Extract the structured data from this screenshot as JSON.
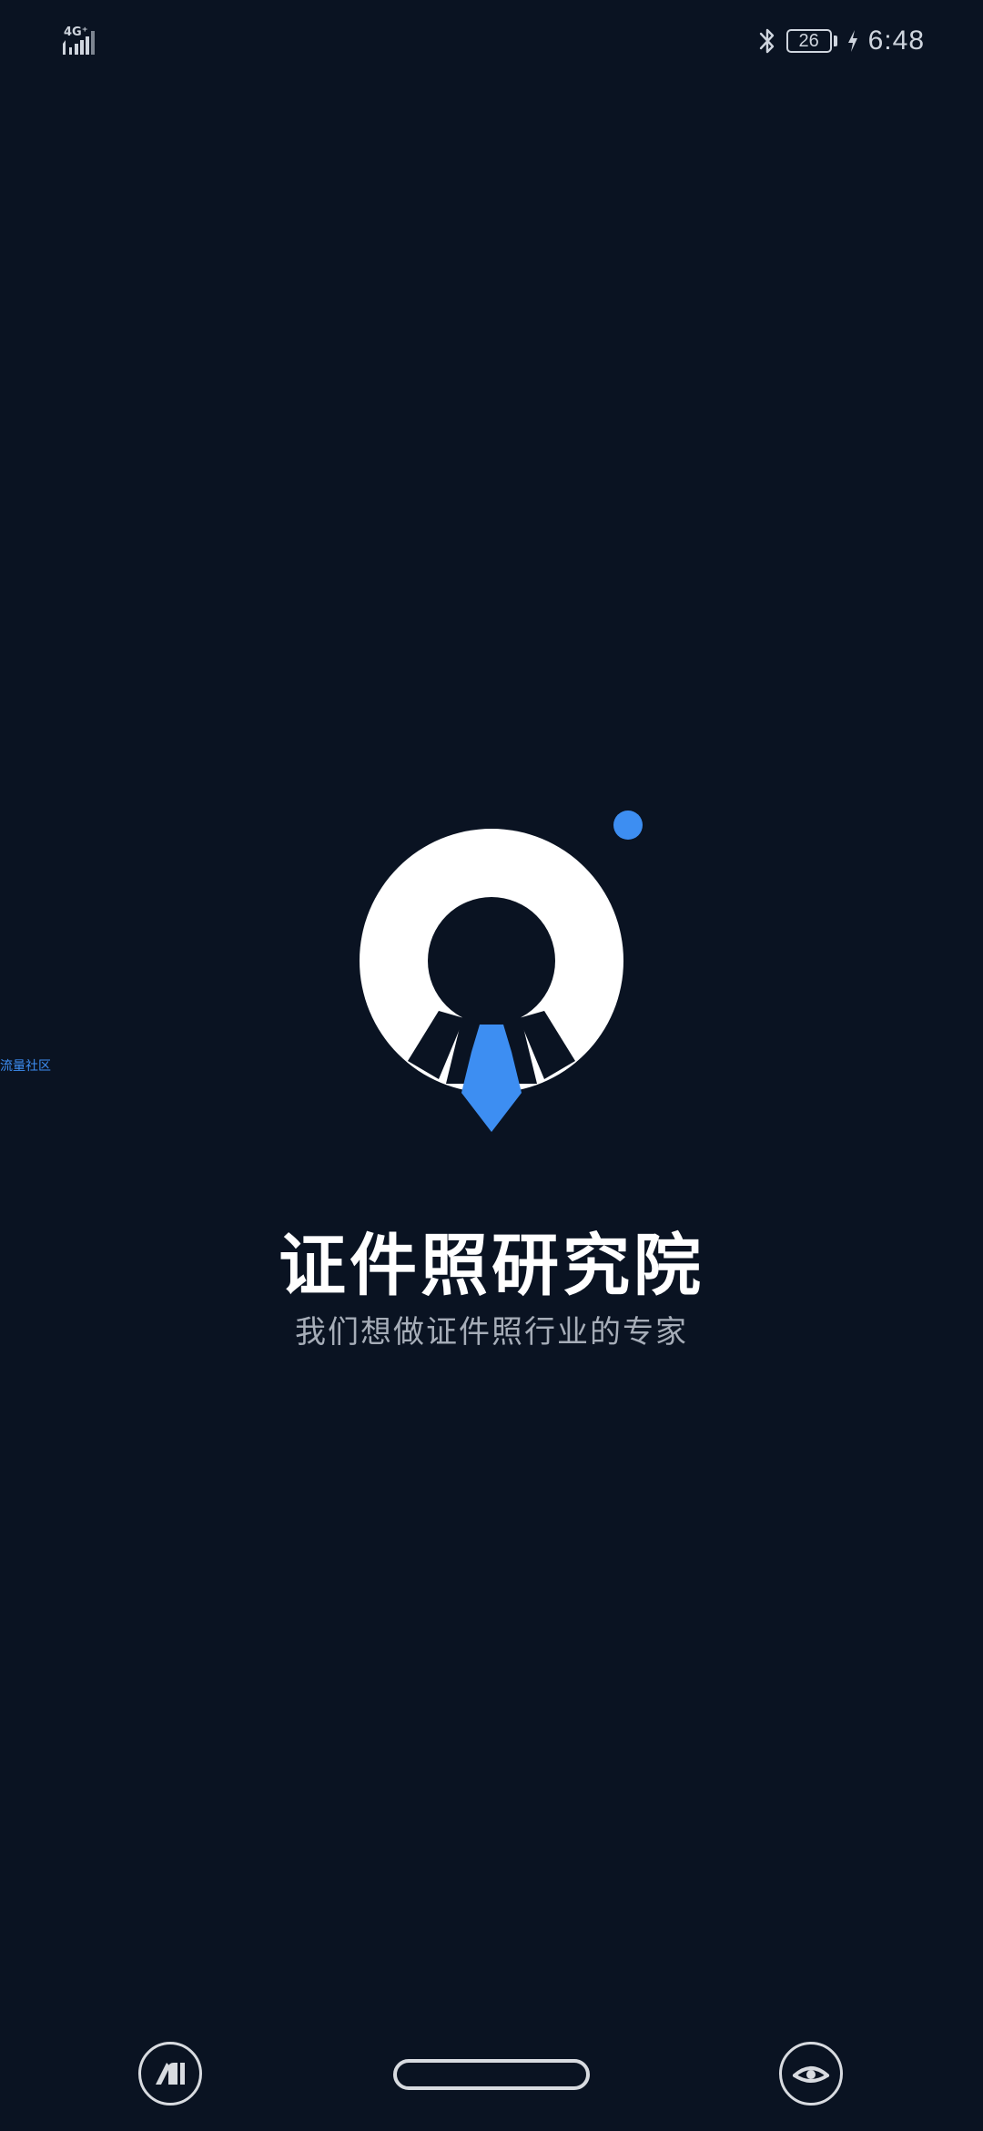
{
  "status_bar": {
    "network": "4G⁺",
    "battery_level": "26",
    "time": "6:48"
  },
  "side_label": "流量社区",
  "app": {
    "name": "证件照研究院",
    "slogan": "我们想做证件照行业的专家"
  },
  "colors": {
    "background": "#0a1322",
    "accent_blue": "#3d8ef2",
    "text_primary": "#ffffff",
    "text_secondary": "#a6adb8"
  },
  "icons": {
    "status": [
      "signal-icon",
      "bluetooth-icon",
      "battery-icon",
      "charging-icon"
    ],
    "nav": [
      "assistant-icon",
      "home-bar",
      "eye-icon"
    ]
  }
}
